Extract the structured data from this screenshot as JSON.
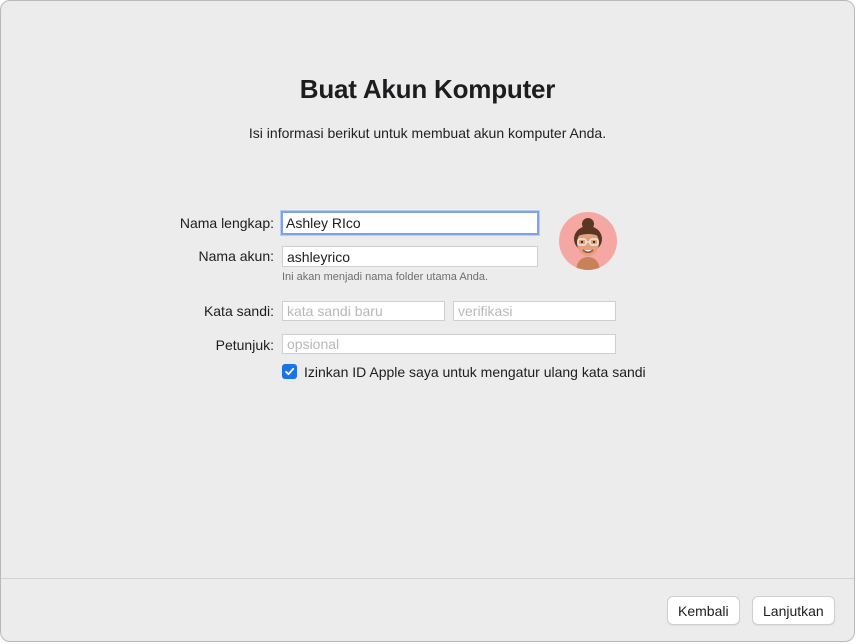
{
  "header": {
    "title": "Buat Akun Komputer",
    "subtitle": "Isi informasi berikut untuk membuat akun komputer Anda."
  },
  "form": {
    "full_name": {
      "label": "Nama lengkap:",
      "value": "Ashley RIco"
    },
    "account_name": {
      "label": "Nama akun:",
      "value": "ashleyrico",
      "hint": "Ini akan menjadi nama folder utama Anda."
    },
    "password": {
      "label": "Kata sandi:",
      "placeholder": "kata sandi baru",
      "verify_placeholder": "verifikasi"
    },
    "hint_field": {
      "label": "Petunjuk:",
      "placeholder": "opsional"
    },
    "apple_id_reset": {
      "label": "Izinkan ID Apple saya untuk mengatur ulang kata sandi",
      "checked": true
    }
  },
  "avatar": {
    "icon": "memoji-avatar-icon",
    "background": "#f5a8a3"
  },
  "footer": {
    "back_label": "Kembali",
    "continue_label": "Lanjutkan"
  },
  "colors": {
    "accent": "#1a73e8",
    "focus_ring": "#7fa2e6",
    "window_bg": "#ececec"
  }
}
